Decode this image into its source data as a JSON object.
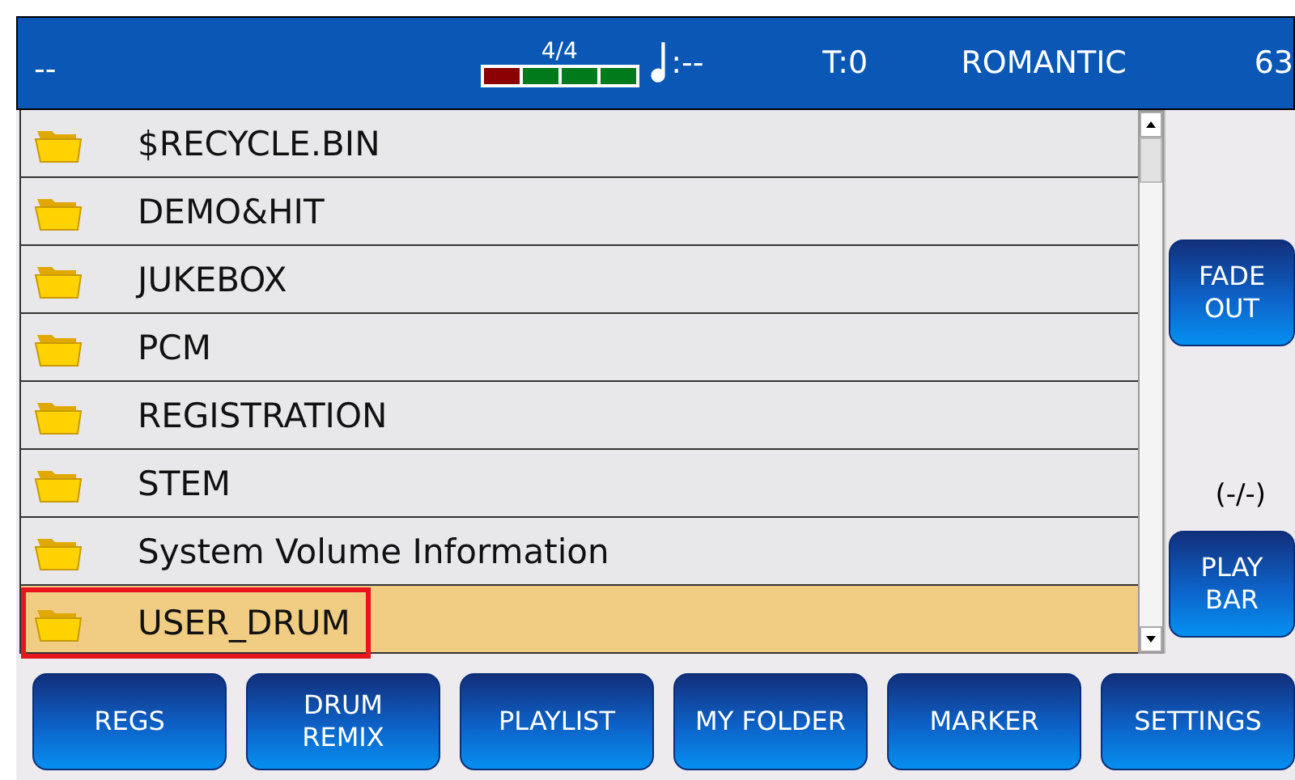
{
  "top_bar": {
    "song": "--",
    "time_signature": "4/4",
    "beats": [
      {
        "color": "#8b0000"
      },
      {
        "color": "#007a1a"
      },
      {
        "color": "#007a1a"
      },
      {
        "color": "#007a1a"
      }
    ],
    "tempo": ":--",
    "transpose": "T:0",
    "style": "ROMANTIC",
    "number": "63"
  },
  "files": [
    {
      "name": "$RECYCLE.BIN",
      "selected": false,
      "marked": false
    },
    {
      "name": "DEMO&HIT",
      "selected": false,
      "marked": false
    },
    {
      "name": "JUKEBOX",
      "selected": false,
      "marked": false
    },
    {
      "name": "PCM",
      "selected": false,
      "marked": false
    },
    {
      "name": "REGISTRATION",
      "selected": false,
      "marked": false
    },
    {
      "name": "STEM",
      "selected": false,
      "marked": false
    },
    {
      "name": "System Volume Information",
      "selected": false,
      "marked": false
    },
    {
      "name": "USER_DRUM",
      "selected": true,
      "marked": true
    }
  ],
  "side": {
    "fade_button": "FADE\nOUT",
    "bar_info": "(-/-)",
    "play_bar_button": "PLAY\nBAR"
  },
  "buttons": [
    "REGS",
    "DRUM\nREMIX",
    "PLAYLIST",
    "MY FOLDER",
    "MARKER",
    "SETTINGS"
  ]
}
